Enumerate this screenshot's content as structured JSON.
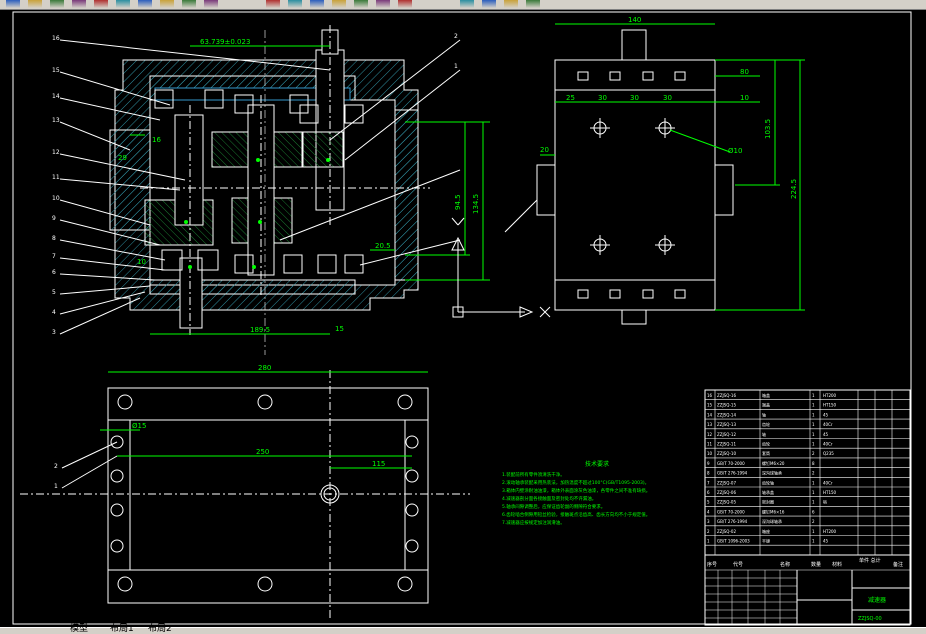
{
  "toolbar": {
    "icons": [
      "new-icon",
      "open-icon",
      "save-icon",
      "print-icon",
      "cut-icon",
      "copy-icon",
      "paste-icon",
      "match-prop-icon",
      "undo-icon",
      "redo-icon",
      "pan-icon",
      "zoom-realtime-icon",
      "zoom-window-icon",
      "zoom-previous-icon",
      "properties-icon",
      "design-center-icon",
      "tool-palette-icon",
      "calculator-icon",
      "help-icon",
      "layer-icon",
      "layer-state-icon"
    ]
  },
  "tabs": [
    "模型",
    "布局1",
    "布局2"
  ],
  "drawing": {
    "front_view": {
      "dims": [
        "63.739±0.023",
        "94.5",
        "134.5",
        "20.5",
        "16",
        "29",
        "10",
        "15",
        "189.5"
      ],
      "leaders": [
        "16",
        "15",
        "14",
        "13",
        "12",
        "11",
        "10",
        "9",
        "8",
        "7",
        "6",
        "5",
        "4",
        "3",
        "2",
        "1"
      ]
    },
    "side_view": {
      "dims": [
        "140",
        "80",
        "10",
        "25",
        "30",
        "30",
        "30",
        "20",
        "103.5",
        "224.5",
        "Ø10"
      ]
    },
    "plan_view": {
      "dims": [
        "280",
        "250",
        "Ø15",
        "115",
        "15"
      ],
      "leaders": [
        "2",
        "1"
      ]
    },
    "notes": {
      "title": "技术要求",
      "lines": [
        "1.装配前所有零件须清洗干净。",
        "2.滚动轴承装配采用热装法，加热温度不超过100°C(GB/T1095-2003)。",
        "3.箱体内壁涂耐油油漆，箱体外表面涂灰色油漆，各零件之间不准有缺损。",
        "4.减速器剖分面各接触面及密封处均不许漏油。",
        "5.轴承间隙调整后，应保证齿轮副的侧隙符合要求。",
        "6.齿轮啮合侧隙用铅丝检验，接触斑点沿齿高、齿长方向均不小于规定值。",
        "7.减速器应按规定加注润滑油。"
      ]
    },
    "title_block": {
      "header": [
        "序号",
        "代号",
        "名称",
        "数量",
        "材料",
        "单件 总计",
        "备注"
      ],
      "rows": [
        [
          "16",
          "ZZJSQ-16",
          "箱盖",
          "1",
          "HT200"
        ],
        [
          "15",
          "ZZJSQ-15",
          "端盖",
          "1",
          "HT150"
        ],
        [
          "14",
          "ZZJSQ-14",
          "轴",
          "1",
          "45"
        ],
        [
          "13",
          "ZZJSQ-13",
          "齿轮",
          "1",
          "40Cr"
        ],
        [
          "12",
          "ZZJSQ-12",
          "轴",
          "1",
          "45"
        ],
        [
          "11",
          "ZZJSQ-11",
          "齿轮",
          "1",
          "40Cr"
        ],
        [
          "10",
          "ZZJSQ-10",
          "套筒",
          "2",
          "Q235"
        ],
        [
          "9",
          "GB/T 70-2000",
          "螺钉M6×20",
          "8",
          ""
        ],
        [
          "8",
          "GB/T 276-1994",
          "深沟球轴承",
          "2",
          ""
        ],
        [
          "7",
          "ZZJSQ-07",
          "齿轮轴",
          "1",
          "40Cr"
        ],
        [
          "6",
          "ZZJSQ-06",
          "轴承盖",
          "1",
          "HT150"
        ],
        [
          "5",
          "ZZJSQ-05",
          "密封圈",
          "1",
          "毡"
        ],
        [
          "4",
          "GB/T 70-2000",
          "螺钉M6×16",
          "6",
          ""
        ],
        [
          "3",
          "GB/T 276-1994",
          "深沟球轴承",
          "2",
          ""
        ],
        [
          "2",
          "ZZJSQ-02",
          "箱座",
          "1",
          "HT200"
        ],
        [
          "1",
          "GB/T 1096-2003",
          "平键",
          "1",
          "45"
        ]
      ],
      "drawing_name": "减速器",
      "drawing_no": "ZZJSQ-00"
    }
  }
}
